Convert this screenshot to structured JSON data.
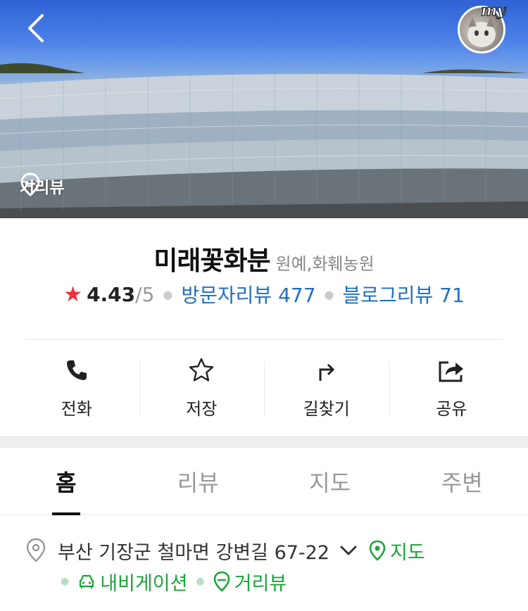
{
  "header": {
    "back_icon": "chevron-left-icon",
    "my_label": "my",
    "roadview_label": "거리뷰"
  },
  "place": {
    "name": "미래꽃화분",
    "category": "원예,화훼농원",
    "rating": "4.43",
    "rating_max": "/5",
    "visitor_reviews": "방문자리뷰 477",
    "blog_reviews": "블로그리뷰 71"
  },
  "actions": [
    {
      "label": "전화",
      "icon": "phone-icon"
    },
    {
      "label": "저장",
      "icon": "star-outline-icon"
    },
    {
      "label": "길찾기",
      "icon": "directions-icon"
    },
    {
      "label": "공유",
      "icon": "share-icon"
    }
  ],
  "tabs": [
    {
      "label": "홈",
      "active": true
    },
    {
      "label": "리뷰",
      "active": false
    },
    {
      "label": "지도",
      "active": false
    },
    {
      "label": "주변",
      "active": false
    }
  ],
  "address": {
    "text": "부산 기장군 철마면 강변길 67-22",
    "map_link": "지도",
    "navigation_link": "내비게이션",
    "roadview_link": "거리뷰"
  },
  "colors": {
    "accent_green": "#1aa43a",
    "link_blue": "#1f6fbf",
    "star_red": "#f0303e"
  }
}
